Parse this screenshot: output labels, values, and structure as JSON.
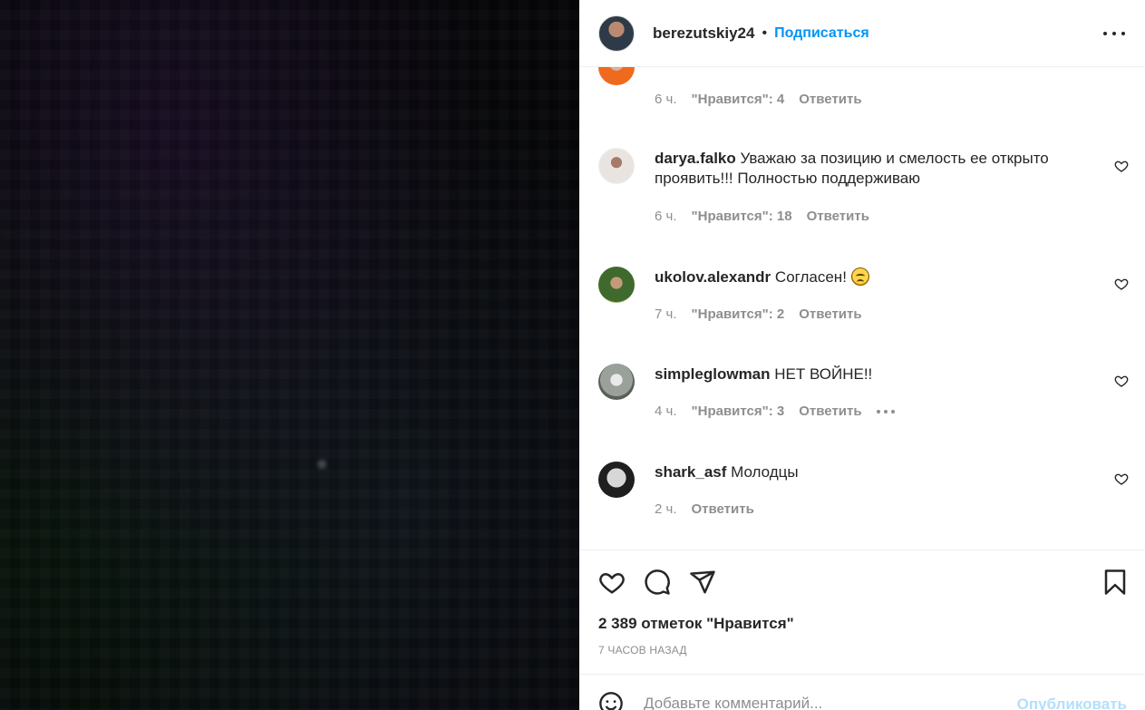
{
  "post": {
    "author": "berezutskiy24",
    "separator": "•",
    "follow_label": "Подписаться",
    "more_icon": "more-horizontal-icon"
  },
  "comments": [
    {
      "username": "",
      "text": "",
      "time": "6 ч.",
      "likes": "\"Нравится\": 4",
      "reply": "Ответить"
    },
    {
      "username": "darya.falko",
      "text": "Уважаю за позицию и смелость ее открыто проявить!!! Полностью поддерживаю",
      "time": "6 ч.",
      "likes": "\"Нравится\": 18",
      "reply": "Ответить"
    },
    {
      "username": "ukolov.alexandr",
      "text": "Согласен!",
      "emoji": "disappointed-face",
      "time": "7 ч.",
      "likes": "\"Нравится\": 2",
      "reply": "Ответить"
    },
    {
      "username": "simpleglowman",
      "text": "НЕТ ВОЙНЕ!!",
      "time": "4 ч.",
      "likes": "\"Нравится\": 3",
      "reply": "Ответить"
    },
    {
      "username": "shark_asf",
      "text": "Молодцы",
      "time": "2 ч.",
      "reply": "Ответить"
    }
  ],
  "actions": {
    "like_icon": "heart-icon",
    "comment_icon": "comment-icon",
    "share_icon": "send-icon",
    "save_icon": "bookmark-icon",
    "likes_count": "2 389 отметок \"Нравится\"",
    "time_ago": "7 ЧАСОВ НАЗАД"
  },
  "add_comment": {
    "placeholder": "Добавьте комментарий...",
    "publish_label": "Опубликовать",
    "emoji_icon": "smile-icon"
  },
  "colors": {
    "link": "#0095f6",
    "muted": "#8e8e8e",
    "text": "#262626",
    "publish_disabled": "#b2dffc"
  }
}
